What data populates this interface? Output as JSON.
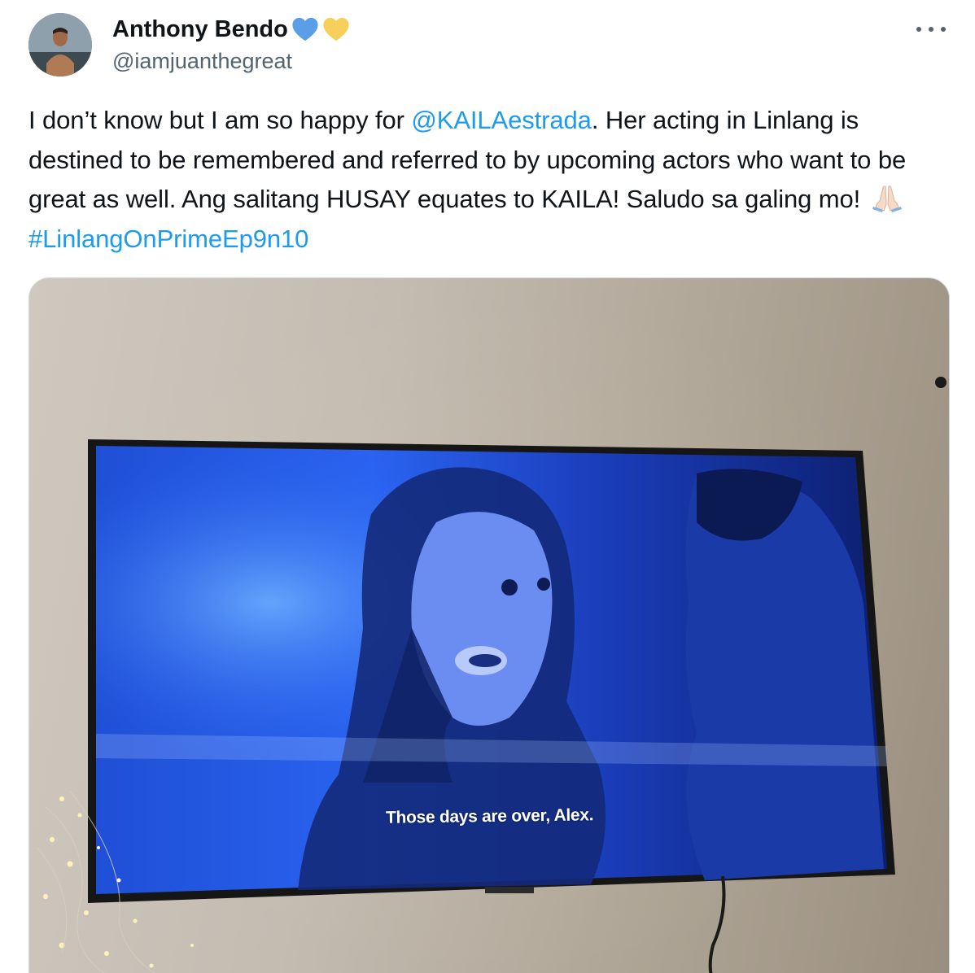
{
  "author": {
    "display_name": "Anthony Bendo",
    "handle": "@iamjuanthegreat",
    "badges": [
      "blue-heart-icon",
      "yellow-heart-icon"
    ],
    "badge_colors": [
      "#5b9ee8",
      "#f7cf5b"
    ]
  },
  "menu": {
    "icon": "more-options-icon"
  },
  "tweet": {
    "text_1": "I don’t know but I am so happy for ",
    "mention": "@KAILAestrada",
    "text_2": ". Her acting in Linlang is destined to be remembered and referred to by upcoming actors who want to be great as well. Ang salitang HUSAY  equates to KAILA! Saludo sa galing mo! ",
    "emoji": "folded-hands-icon",
    "hashtag": "#LinlangOnPrimeEp9n10"
  },
  "media": {
    "subtitle": "Those days are over, Alex."
  },
  "colors": {
    "link": "#1d9bf0",
    "secondary_text": "#536471",
    "primary_text": "#0f1419",
    "border": "#cfd9de"
  }
}
